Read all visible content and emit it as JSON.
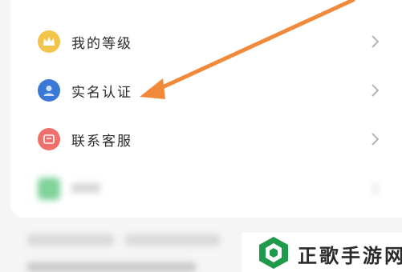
{
  "menu": {
    "items": [
      {
        "label": "我的等级",
        "icon": "crown-icon",
        "icon_color": "#f3c44a"
      },
      {
        "label": "实名认证",
        "icon": "user-id-icon",
        "icon_color": "#3a78d6"
      },
      {
        "label": "联系客服",
        "icon": "customer-service-icon",
        "icon_color": "#ef6f6a"
      },
      {
        "label": "",
        "icon": "settings-icon",
        "icon_color": "#7fd39b"
      }
    ]
  },
  "annotation": {
    "arrow_color": "#f08a3a",
    "points_to": "实名认证"
  },
  "watermark": {
    "text": "正歌手游网",
    "logo_color": "#1f9a4a"
  }
}
